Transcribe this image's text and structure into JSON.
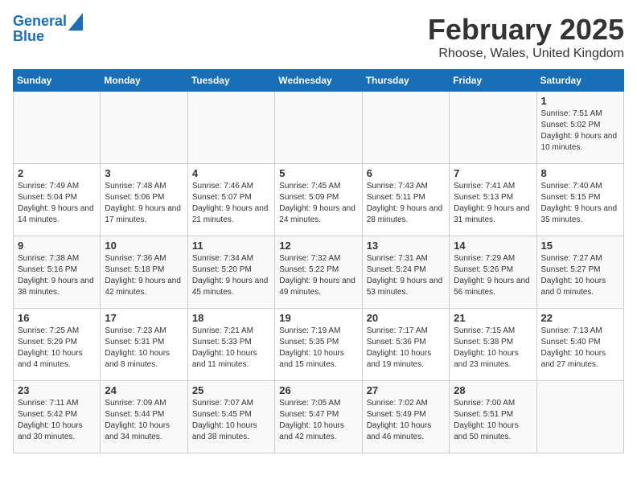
{
  "logo": {
    "line1": "General",
    "line2": "Blue"
  },
  "title": "February 2025",
  "location": "Rhoose, Wales, United Kingdom",
  "headers": [
    "Sunday",
    "Monday",
    "Tuesday",
    "Wednesday",
    "Thursday",
    "Friday",
    "Saturday"
  ],
  "weeks": [
    [
      {
        "day": "",
        "info": ""
      },
      {
        "day": "",
        "info": ""
      },
      {
        "day": "",
        "info": ""
      },
      {
        "day": "",
        "info": ""
      },
      {
        "day": "",
        "info": ""
      },
      {
        "day": "",
        "info": ""
      },
      {
        "day": "1",
        "info": "Sunrise: 7:51 AM\nSunset: 5:02 PM\nDaylight: 9 hours and 10 minutes."
      }
    ],
    [
      {
        "day": "2",
        "info": "Sunrise: 7:49 AM\nSunset: 5:04 PM\nDaylight: 9 hours and 14 minutes."
      },
      {
        "day": "3",
        "info": "Sunrise: 7:48 AM\nSunset: 5:06 PM\nDaylight: 9 hours and 17 minutes."
      },
      {
        "day": "4",
        "info": "Sunrise: 7:46 AM\nSunset: 5:07 PM\nDaylight: 9 hours and 21 minutes."
      },
      {
        "day": "5",
        "info": "Sunrise: 7:45 AM\nSunset: 5:09 PM\nDaylight: 9 hours and 24 minutes."
      },
      {
        "day": "6",
        "info": "Sunrise: 7:43 AM\nSunset: 5:11 PM\nDaylight: 9 hours and 28 minutes."
      },
      {
        "day": "7",
        "info": "Sunrise: 7:41 AM\nSunset: 5:13 PM\nDaylight: 9 hours and 31 minutes."
      },
      {
        "day": "8",
        "info": "Sunrise: 7:40 AM\nSunset: 5:15 PM\nDaylight: 9 hours and 35 minutes."
      }
    ],
    [
      {
        "day": "9",
        "info": "Sunrise: 7:38 AM\nSunset: 5:16 PM\nDaylight: 9 hours and 38 minutes."
      },
      {
        "day": "10",
        "info": "Sunrise: 7:36 AM\nSunset: 5:18 PM\nDaylight: 9 hours and 42 minutes."
      },
      {
        "day": "11",
        "info": "Sunrise: 7:34 AM\nSunset: 5:20 PM\nDaylight: 9 hours and 45 minutes."
      },
      {
        "day": "12",
        "info": "Sunrise: 7:32 AM\nSunset: 5:22 PM\nDaylight: 9 hours and 49 minutes."
      },
      {
        "day": "13",
        "info": "Sunrise: 7:31 AM\nSunset: 5:24 PM\nDaylight: 9 hours and 53 minutes."
      },
      {
        "day": "14",
        "info": "Sunrise: 7:29 AM\nSunset: 5:26 PM\nDaylight: 9 hours and 56 minutes."
      },
      {
        "day": "15",
        "info": "Sunrise: 7:27 AM\nSunset: 5:27 PM\nDaylight: 10 hours and 0 minutes."
      }
    ],
    [
      {
        "day": "16",
        "info": "Sunrise: 7:25 AM\nSunset: 5:29 PM\nDaylight: 10 hours and 4 minutes."
      },
      {
        "day": "17",
        "info": "Sunrise: 7:23 AM\nSunset: 5:31 PM\nDaylight: 10 hours and 8 minutes."
      },
      {
        "day": "18",
        "info": "Sunrise: 7:21 AM\nSunset: 5:33 PM\nDaylight: 10 hours and 11 minutes."
      },
      {
        "day": "19",
        "info": "Sunrise: 7:19 AM\nSunset: 5:35 PM\nDaylight: 10 hours and 15 minutes."
      },
      {
        "day": "20",
        "info": "Sunrise: 7:17 AM\nSunset: 5:36 PM\nDaylight: 10 hours and 19 minutes."
      },
      {
        "day": "21",
        "info": "Sunrise: 7:15 AM\nSunset: 5:38 PM\nDaylight: 10 hours and 23 minutes."
      },
      {
        "day": "22",
        "info": "Sunrise: 7:13 AM\nSunset: 5:40 PM\nDaylight: 10 hours and 27 minutes."
      }
    ],
    [
      {
        "day": "23",
        "info": "Sunrise: 7:11 AM\nSunset: 5:42 PM\nDaylight: 10 hours and 30 minutes."
      },
      {
        "day": "24",
        "info": "Sunrise: 7:09 AM\nSunset: 5:44 PM\nDaylight: 10 hours and 34 minutes."
      },
      {
        "day": "25",
        "info": "Sunrise: 7:07 AM\nSunset: 5:45 PM\nDaylight: 10 hours and 38 minutes."
      },
      {
        "day": "26",
        "info": "Sunrise: 7:05 AM\nSunset: 5:47 PM\nDaylight: 10 hours and 42 minutes."
      },
      {
        "day": "27",
        "info": "Sunrise: 7:02 AM\nSunset: 5:49 PM\nDaylight: 10 hours and 46 minutes."
      },
      {
        "day": "28",
        "info": "Sunrise: 7:00 AM\nSunset: 5:51 PM\nDaylight: 10 hours and 50 minutes."
      },
      {
        "day": "",
        "info": ""
      }
    ]
  ]
}
